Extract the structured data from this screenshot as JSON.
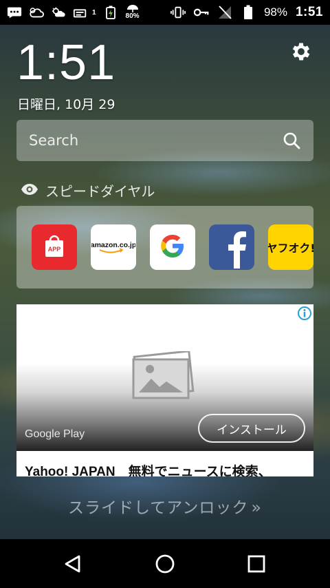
{
  "status_bar": {
    "notif_count": "1",
    "rain_chance": "80%",
    "battery": "98%",
    "time": "1:51"
  },
  "lock": {
    "clock": "1:51",
    "date": "日曜日, 10月 29"
  },
  "search": {
    "placeholder": "Search"
  },
  "speed_dial": {
    "label": "スピードダイヤル",
    "items": [
      {
        "name": "APP",
        "icon": "app-store-icon",
        "color": "#e82a2f"
      },
      {
        "name": "amazon.co.jp",
        "icon": "amazon-icon",
        "color": "#ffffff"
      },
      {
        "name": "G",
        "icon": "google-icon",
        "color": "#ffffff"
      },
      {
        "name": "f",
        "icon": "facebook-icon",
        "color": "#3b5998"
      },
      {
        "name": "ヤフオク!",
        "icon": "yahuoku-icon",
        "color": "#ffd400"
      }
    ]
  },
  "ad": {
    "source": "Google Play",
    "install_label": "インストール",
    "title": "Yahoo! JAPAN　無料でニュースに検索、"
  },
  "unlock": {
    "label": "スライドしてアンロック",
    "arrow": "»"
  }
}
